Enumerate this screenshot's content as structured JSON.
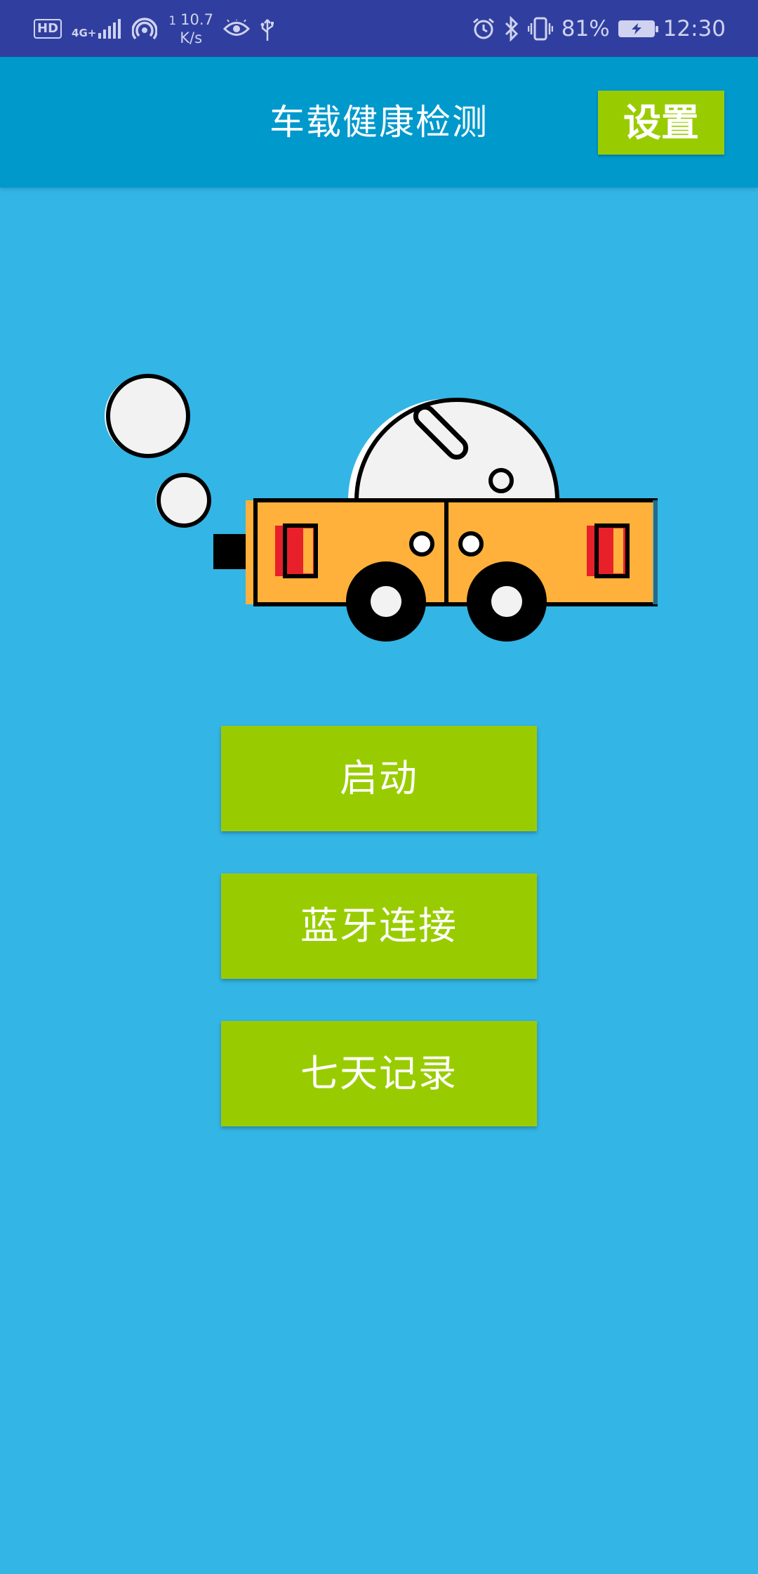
{
  "status_bar": {
    "hd_badge": "HD",
    "network_type": "4G+",
    "speed_prefix": "1",
    "speed_value": "10.7",
    "speed_unit": "K/s",
    "battery_percent": "81%",
    "time": "12:30",
    "icons": [
      "signal-icon",
      "hotspot-icon",
      "eye-icon",
      "usb-icon",
      "alarm-icon",
      "bluetooth-icon",
      "vibrate-icon",
      "battery-charging-icon"
    ]
  },
  "app_bar": {
    "title": "车载健康检测",
    "settings_label": "设置"
  },
  "illustration": {
    "icon": "car-illustration"
  },
  "menu": {
    "start_label": "启动",
    "bluetooth_label": "蓝牙连接",
    "records_label": "七天记录"
  },
  "colors": {
    "status_bar": "#303f9f",
    "app_bar": "#0099cc",
    "background": "#33b5e5",
    "button": "#99cc00",
    "car_body": "#ffb13b",
    "tail_light": "#e8202a"
  }
}
